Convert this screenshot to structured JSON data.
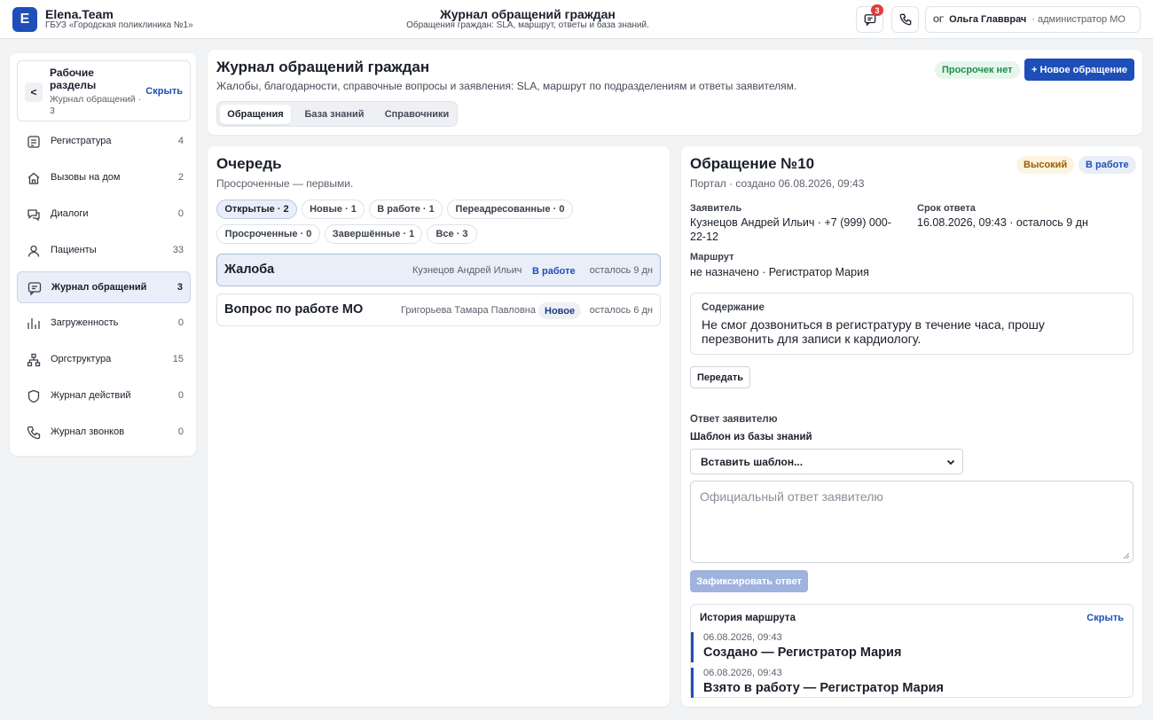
{
  "topbar": {
    "logo_letter": "E",
    "brand": "Elena.Team",
    "org": "ГБУЗ «Городская поликлиника №1»",
    "title": "Журнал обращений граждан",
    "subtitle": "Обращения граждан: SLA, маршрут, ответы и база знаний.",
    "notifications_count": "3",
    "user_initials": "ОГ",
    "user_name": "Ольга Главврач",
    "user_role": "· администратор МО"
  },
  "sidebar": {
    "header_title": "Рабочие разделы",
    "header_sub": "Журнал обращений · 3",
    "collapse_label": "<",
    "hide_label": "Скрыть",
    "items": [
      {
        "label": "Регистратура",
        "count": "4",
        "icon": "registry-icon"
      },
      {
        "label": "Вызовы на дом",
        "count": "2",
        "icon": "home-icon"
      },
      {
        "label": "Диалоги",
        "count": "0",
        "icon": "dialog-icon"
      },
      {
        "label": "Пациенты",
        "count": "33",
        "icon": "user-icon"
      },
      {
        "label": "Журнал обращений",
        "count": "3",
        "icon": "chat-icon"
      },
      {
        "label": "Загруженность",
        "count": "0",
        "icon": "bar-chart-icon"
      },
      {
        "label": "Оргструктура",
        "count": "15",
        "icon": "org-chart-icon"
      },
      {
        "label": "Журнал действий",
        "count": "0",
        "icon": "shield-icon"
      },
      {
        "label": "Журнал звонков",
        "count": "0",
        "icon": "phone-icon"
      }
    ]
  },
  "header": {
    "title": "Журнал обращений граждан",
    "subtitle": "Жалобы, благодарности, справочные вопросы и заявления: SLA, маршрут по подразделениям и ответы заявителям.",
    "overdue_label": "Просрочек нет",
    "new_button": "+ Новое обращение",
    "tabs": [
      "Обращения",
      "База знаний",
      "Справочники"
    ]
  },
  "queue": {
    "title": "Очередь",
    "subtitle": "Просроченные — первыми.",
    "filters": [
      "Открытые · 2",
      "Новые · 1",
      "В работе · 1",
      "Переадресованные · 0",
      "Просроченные · 0",
      "Завершённые · 1",
      "Все · 3"
    ],
    "rows": [
      {
        "title": "Жалоба",
        "person": "Кузнецов Андрей Ильич",
        "status": "В работе",
        "remaining": "осталось 9 дн"
      },
      {
        "title": "Вопрос по работе МО",
        "person": "Григорьева Тамара Павловна",
        "status": "Новое",
        "remaining": "осталось 6 дн"
      }
    ]
  },
  "detail": {
    "title": "Обращение №10",
    "subtitle": "Портал · создано 06.08.2026, 09:43",
    "priority": "Высокий",
    "status": "В работе",
    "applicant_label": "Заявитель",
    "applicant_value": "Кузнецов Андрей Ильич · +7 (999) 000-22-12",
    "deadline_label": "Срок ответа",
    "deadline_value": "16.08.2026, 09:43 · осталось 9 дн",
    "route_label": "Маршрут",
    "route_value": "не назначено · Регистратор Мария",
    "content_label": "Содержание",
    "content_text": "Не смог дозвониться в регистратуру в течение часа, прошу перезвонить для записи к кардиологу.",
    "transfer_button": "Передать",
    "answer_label": "Ответ заявителю",
    "template_label": "Шаблон из базы знаний",
    "template_select": "Вставить шаблон...",
    "answer_placeholder": "Официальный ответ заявителю",
    "fix_button": "Зафиксировать ответ",
    "history_title": "История маршрута",
    "history_hide": "Скрыть",
    "history": [
      {
        "time": "06.08.2026, 09:43",
        "text": "Создано — Регистратор Мария"
      },
      {
        "time": "06.08.2026, 09:43",
        "text": "Взято в работу — Регистратор Мария"
      }
    ]
  },
  "colors": {
    "accent": "#1e4fb8",
    "overdue_ok_bg": "#e7f6ec",
    "overdue_ok_text": "#1e8f4e",
    "priority_high_bg": "#fdf3df",
    "priority_high_text": "#9a5b06",
    "notif_badge": "#e23b3b"
  }
}
